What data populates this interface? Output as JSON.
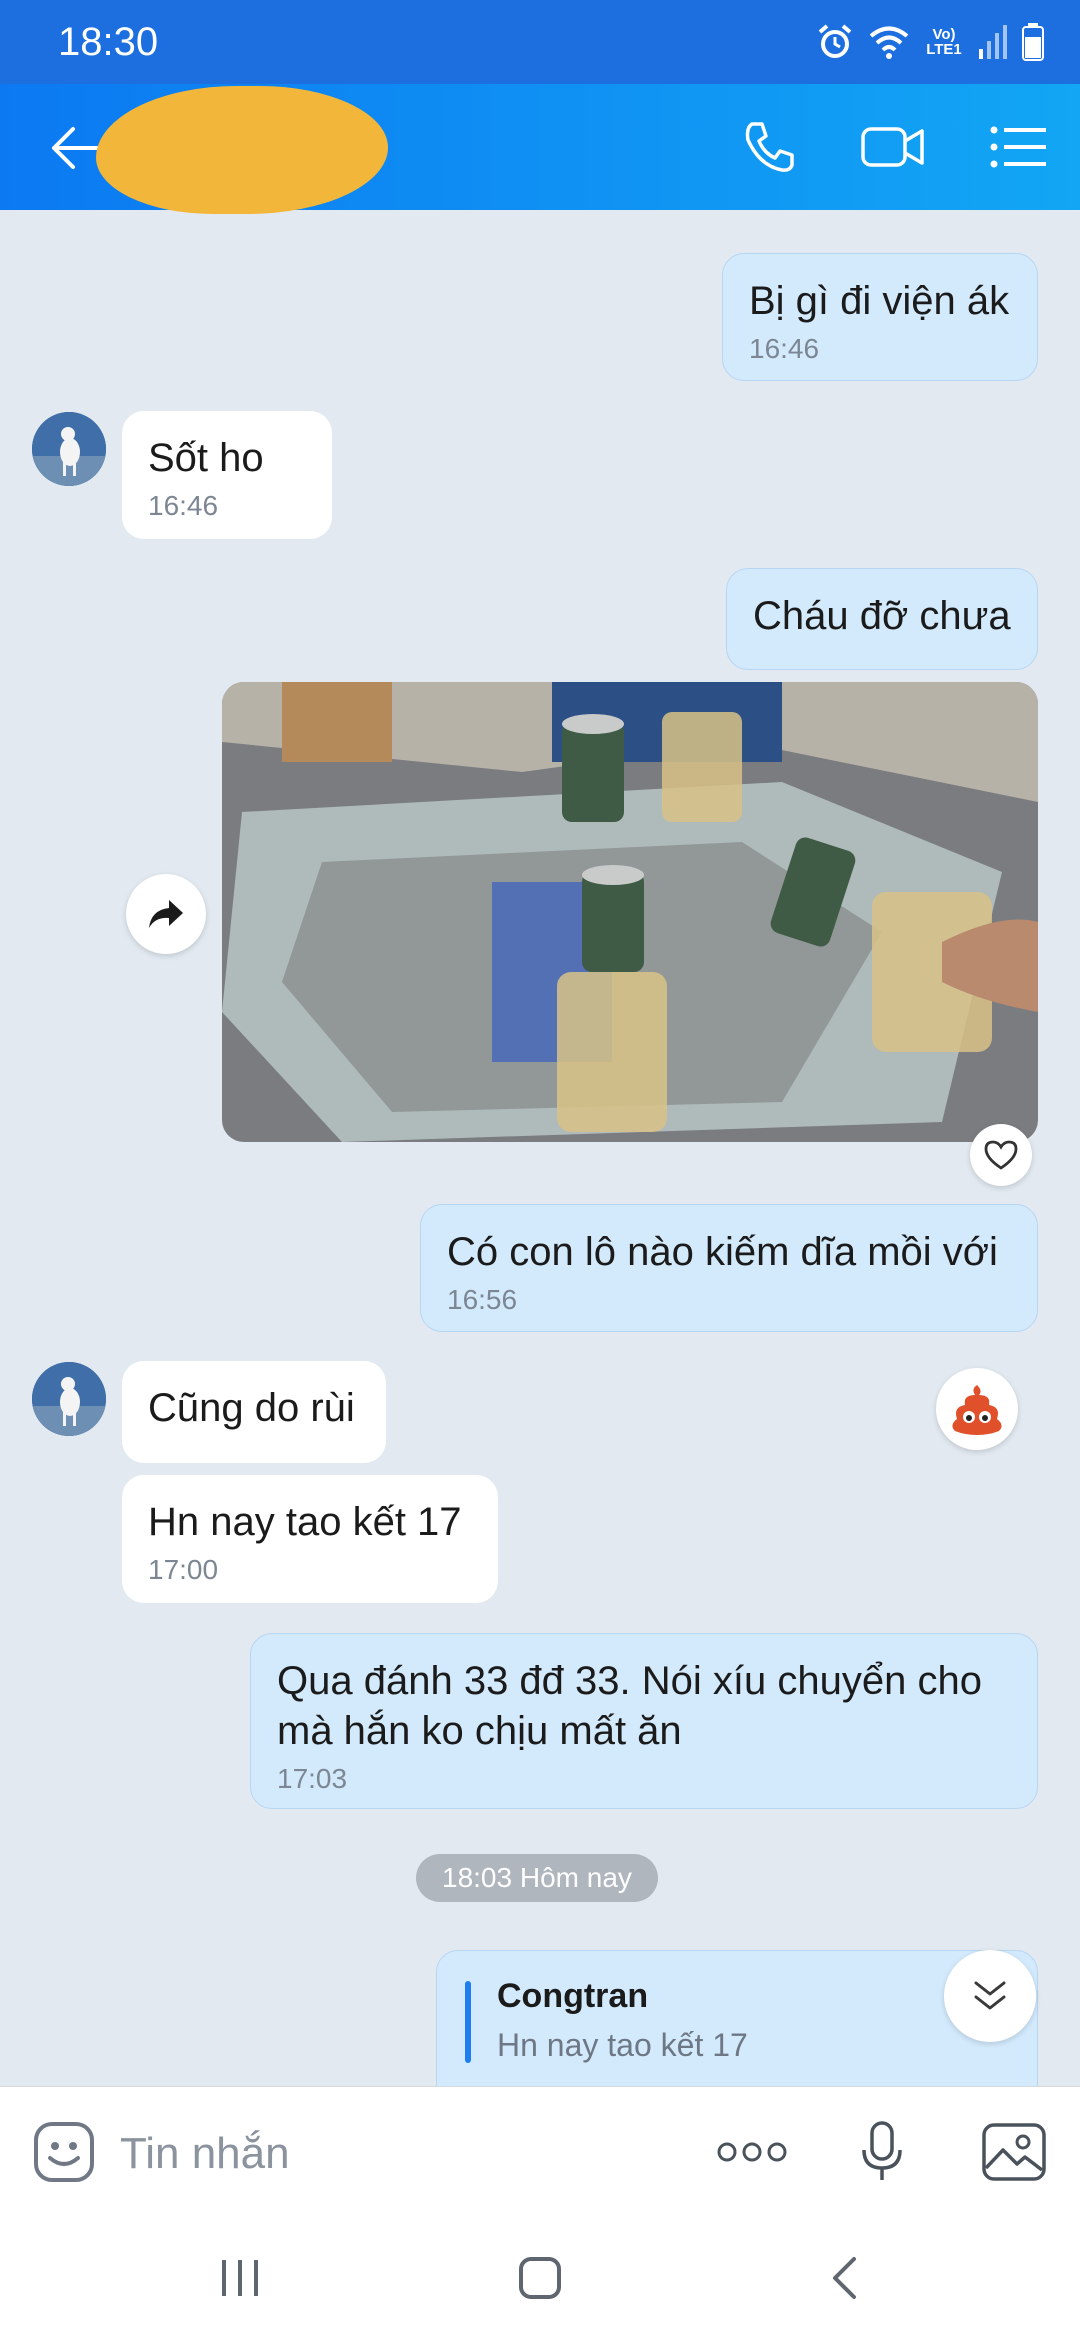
{
  "status_bar": {
    "time": "18:30",
    "network": "Vo) LTE1"
  },
  "header": {
    "contact_name": ""
  },
  "messages": [
    {
      "text": "Bị gì đi viện ák",
      "time": "16:46"
    },
    {
      "text": "Sốt ho",
      "time": "16:46"
    },
    {
      "text": "Cháu đỡ chưa"
    },
    {
      "text": "Có con lô nào kiếm dĩa mồi với",
      "time": "16:56"
    },
    {
      "text": "Cũng do rùi"
    },
    {
      "text": "Hn nay tao kết 17",
      "time": "17:00"
    },
    {
      "text": "Qua đánh 33 đđ 33. Nói xíu chuyển cho mà hắn ko chịu mất ăn",
      "time": "17:03"
    }
  ],
  "date_separator": "18:03 Hôm nay",
  "reply_preview": {
    "author": "Congtran",
    "text": "Hn nay tao kết 17"
  },
  "input": {
    "placeholder": "Tin nhắn"
  },
  "colors": {
    "header_start": "#0c79f2",
    "header_end": "#12a6f4",
    "outgoing_bubble": "#d3eafd",
    "incoming_bubble": "#ffffff",
    "background": "#e2e9f1"
  }
}
